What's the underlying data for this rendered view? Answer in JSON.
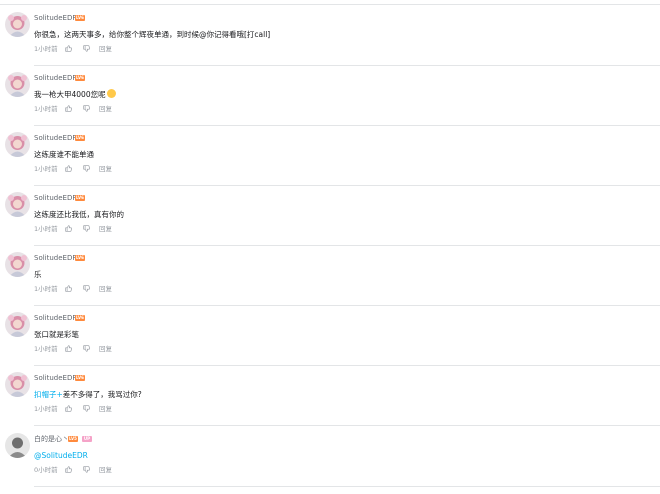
{
  "comments": [
    {
      "user": "SolitudeEDR",
      "level": "LV6",
      "text": "你很急，这两天事多，给你整个辉夜单通，到时候@你记得看哦[打call]",
      "time": "1小时前",
      "reply": "回复"
    },
    {
      "user": "SolitudeEDR",
      "level": "LV6",
      "text": "我一枪大甲4000您呢",
      "emoji": "smile-emoji",
      "time": "1小时前",
      "reply": "回复"
    },
    {
      "user": "SolitudeEDR",
      "level": "LV6",
      "text": "这练度谁不能单通",
      "time": "1小时前",
      "reply": "回复"
    },
    {
      "user": "SolitudeEDR",
      "level": "LV6",
      "text": "这练度还比我低，真有你的",
      "time": "1小时前",
      "reply": "回复"
    },
    {
      "user": "SolitudeEDR",
      "level": "LV6",
      "text": "乐",
      "time": "1小时前",
      "reply": "回复"
    },
    {
      "user": "SolitudeEDR",
      "level": "LV6",
      "text": "张口就是彩笔",
      "time": "1小时前",
      "reply": "回复"
    },
    {
      "user": "SolitudeEDR",
      "level": "LV6",
      "mention": "扣帽子+",
      "text": "差不多得了，我骂过你?",
      "time": "1小时前",
      "reply": "回复"
    },
    {
      "user": "白的是心丶",
      "level": "LV5",
      "badge": "UP",
      "mention": "@SolitudeEDR",
      "text": "",
      "time": "0小时前",
      "reply": "回复"
    }
  ],
  "colors": {
    "link": "#00aeec",
    "level_badge": "#ff8a3d",
    "meta": "#9499a0"
  },
  "icons": {
    "like": "thumb-up-icon",
    "dislike": "thumb-down-icon"
  }
}
